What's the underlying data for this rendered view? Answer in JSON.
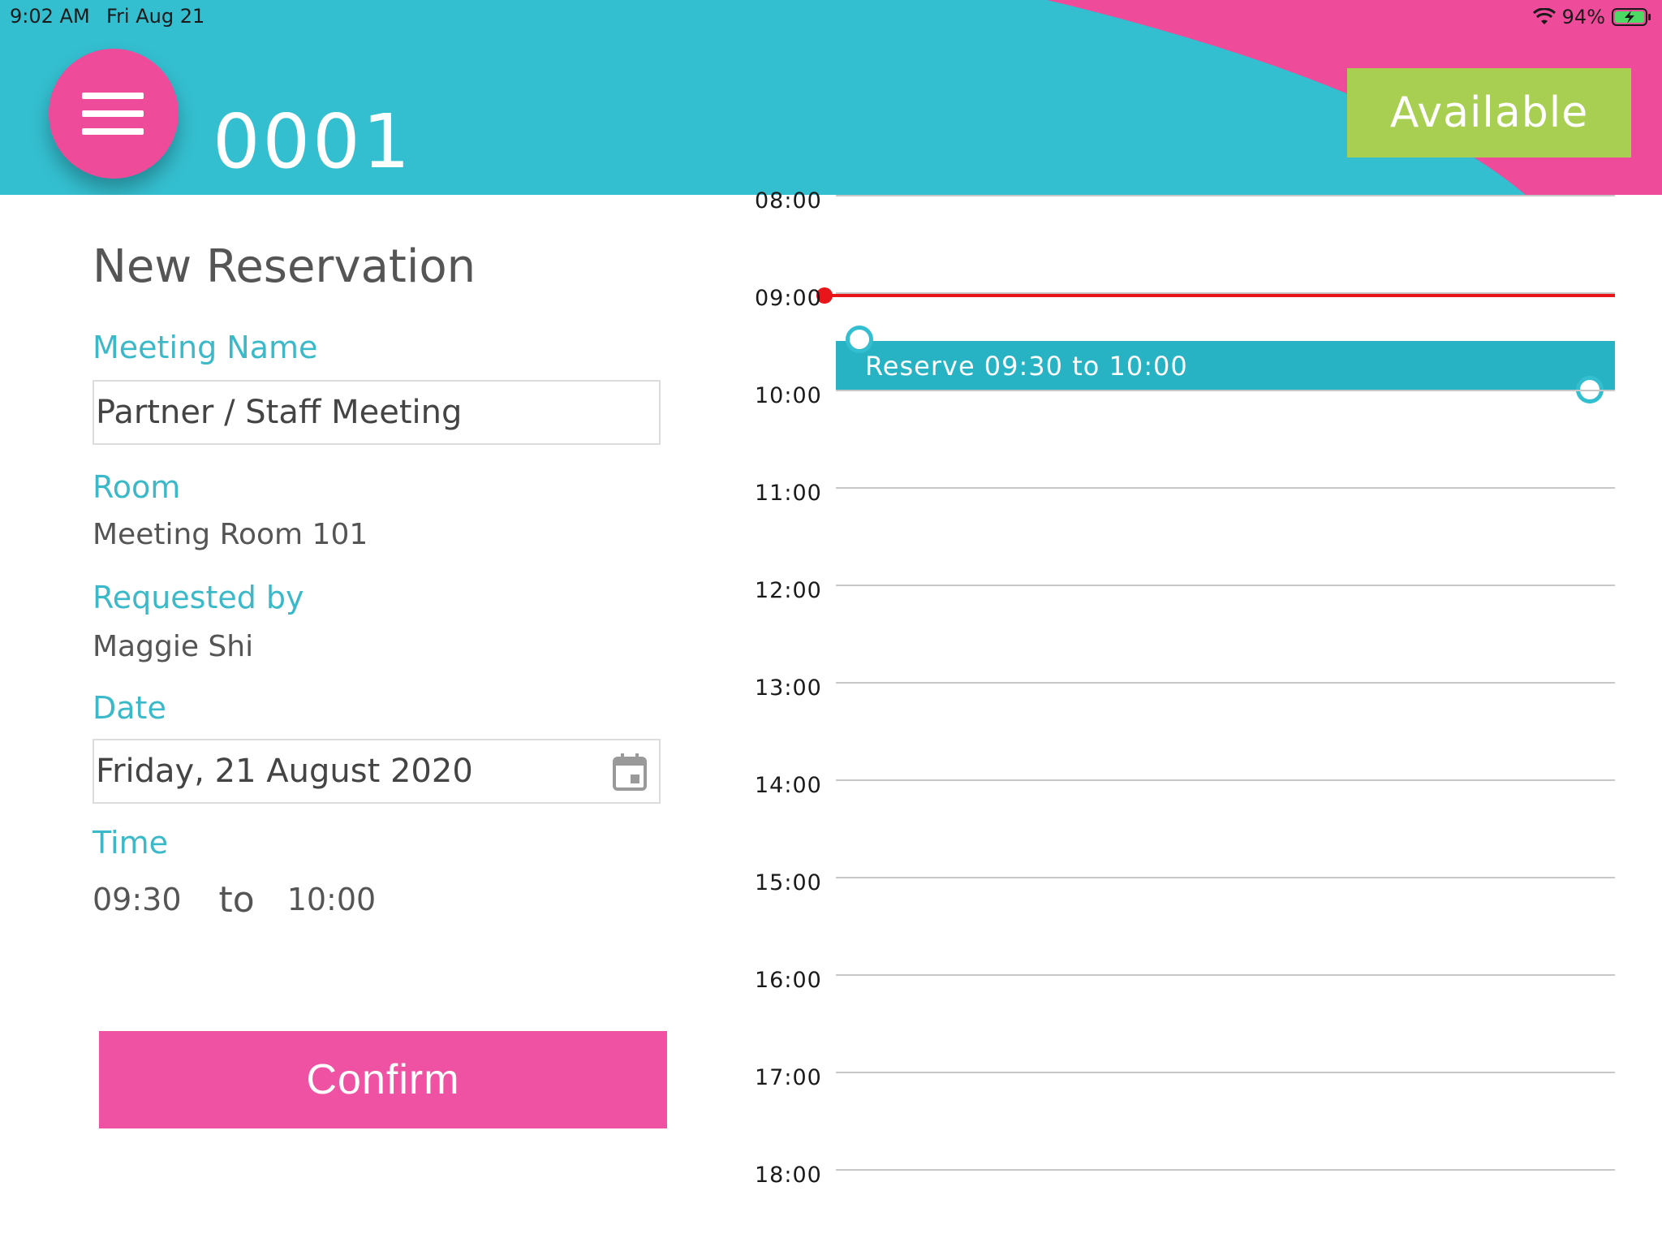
{
  "status_bar": {
    "time": "9:02 AM",
    "date": "Fri Aug 21",
    "battery": "94%"
  },
  "header": {
    "room_code": "0001",
    "status": "Available",
    "colors": {
      "primary": "#34bfd0",
      "accent": "#ee4b9b",
      "available": "#a8cf51"
    }
  },
  "form": {
    "title": "New Reservation",
    "meeting_name": {
      "label": "Meeting Name",
      "value": "Partner / Staff Meeting"
    },
    "room": {
      "label": "Room",
      "value": "Meeting Room 101"
    },
    "requested_by": {
      "label": "Requested by",
      "value": "Maggie Shi"
    },
    "date": {
      "label": "Date",
      "value": "Friday, 21 August 2020",
      "icon": "calendar-icon"
    },
    "time": {
      "label": "Time",
      "start": "09:30",
      "separator": "to",
      "end": "10:00"
    },
    "confirm_label": "Confirm"
  },
  "timeline": {
    "hours": [
      "08:00",
      "09:00",
      "10:00",
      "11:00",
      "12:00",
      "13:00",
      "14:00",
      "15:00",
      "16:00",
      "17:00",
      "18:00"
    ],
    "current_time": "09:02",
    "reservation": {
      "label": "Reserve 09:30 to 10:00",
      "start": "09:30",
      "end": "10:00"
    }
  }
}
